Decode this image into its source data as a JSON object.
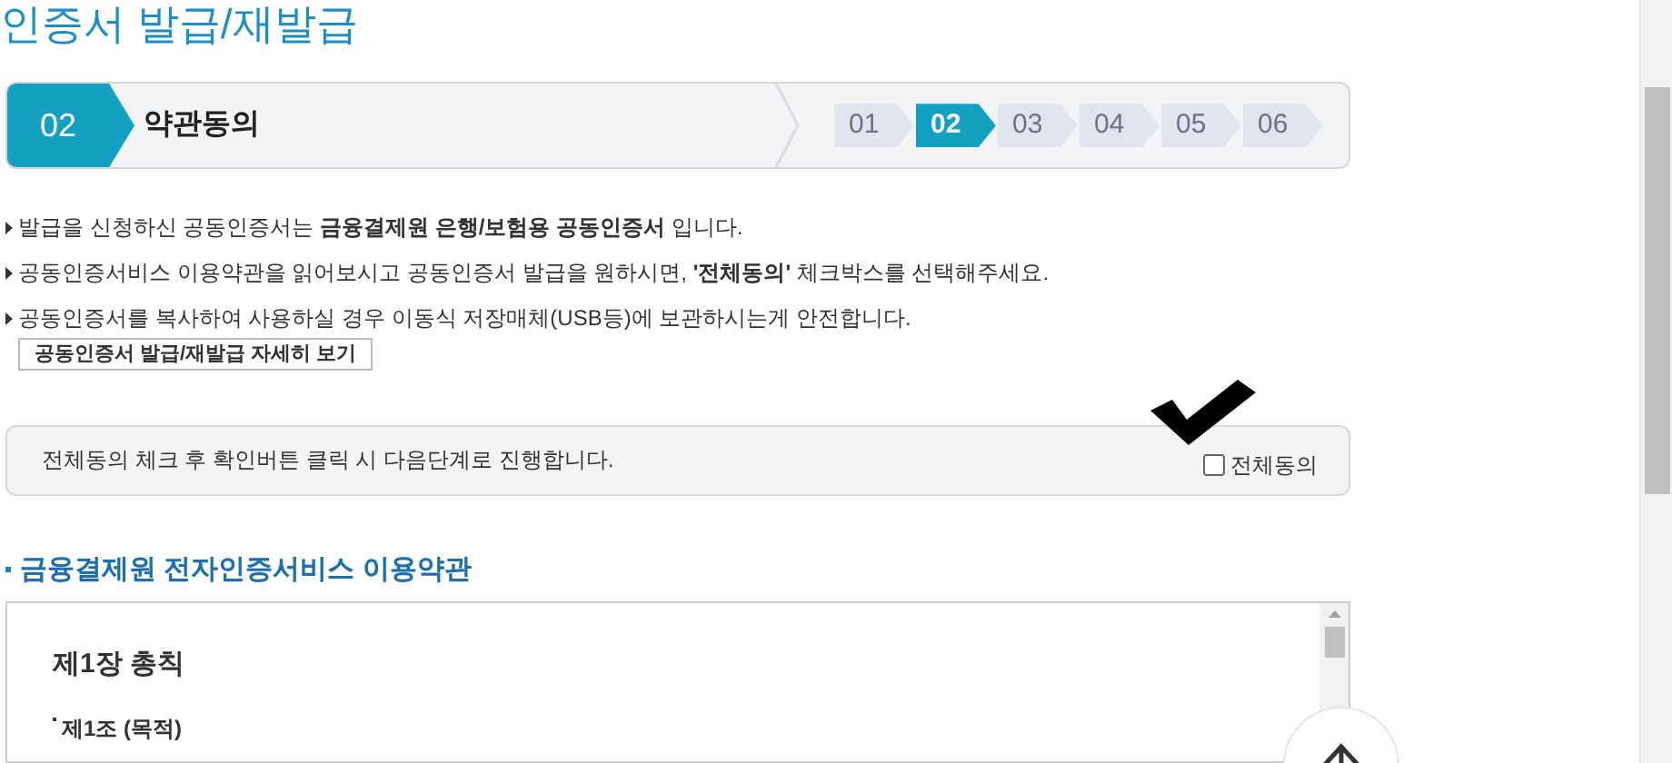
{
  "page_title": "인증서 발급/재발급",
  "current_step": {
    "number": "02",
    "name": "약관동의"
  },
  "steps": [
    {
      "label": "01",
      "selected": false
    },
    {
      "label": "02",
      "selected": true
    },
    {
      "label": "03",
      "selected": false
    },
    {
      "label": "04",
      "selected": false
    },
    {
      "label": "05",
      "selected": false
    },
    {
      "label": "06",
      "selected": false
    }
  ],
  "notes": [
    "발급을 신청하신 공동인증서는 **금융결제원 은행/보험용 공동인증서** 입니다.",
    "공동인증서비스 이용약관을 읽어보시고 공동인증서 발급을 원하시면, **'전체동의'** 체크박스를 선택해주세요.",
    "공동인증서를 복사하여 사용하실 경우 이동식 저장매체(USB등)에 보관하시는게 안전합니다."
  ],
  "detail_button": "공동인증서 발급/재발급 자세히 보기",
  "agree_notice": {
    "text": "전체동의 체크 후 확인버튼 클릭 시 다음단계로 진행합니다.",
    "checkbox_label": "전체동의",
    "checked": false
  },
  "terms": {
    "title": "금융결제원 전자인증서비스 이용약관",
    "chapter": "제1장 총칙",
    "article": "제1조 (목적)"
  }
}
